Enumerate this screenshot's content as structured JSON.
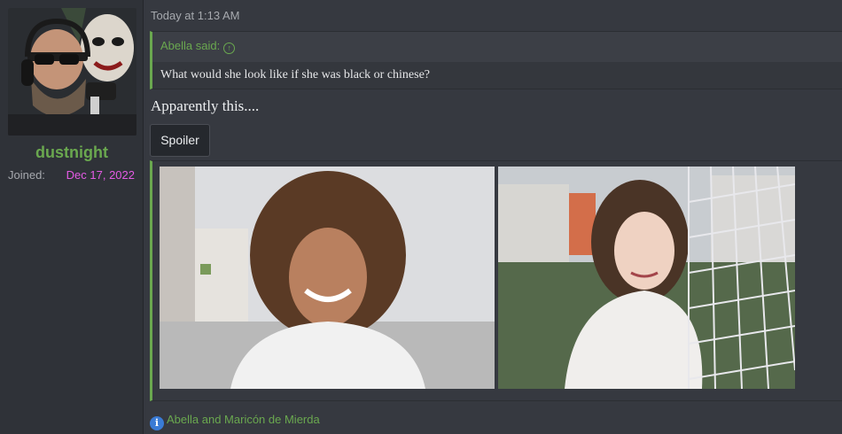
{
  "user": {
    "name": "dustnight",
    "joined_label": "Joined:",
    "joined_date": "Dec 17, 2022"
  },
  "post": {
    "timestamp": "Today at 1:13 AM",
    "quote": {
      "author_line": "Abella said:",
      "text": "What would she look like if she was black or chinese?"
    },
    "body": "Apparently this....",
    "spoiler_label": "Spoiler",
    "reactions": "Abella and Maricón de Mierda"
  },
  "colors": {
    "accent": "#6aa84f",
    "joined_date": "#e55be5",
    "info": "#3a7bd5"
  }
}
